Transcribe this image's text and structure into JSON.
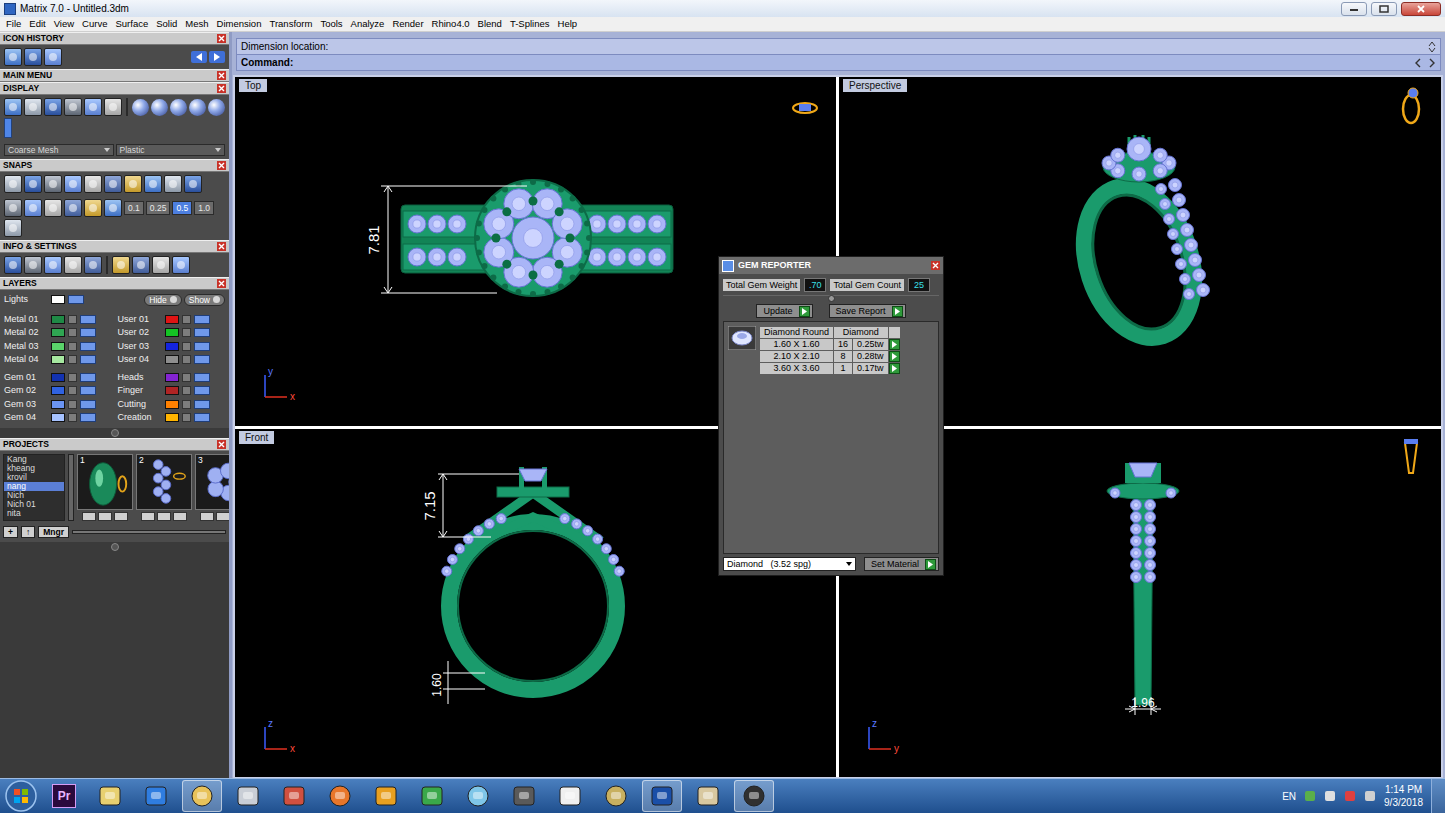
{
  "window": {
    "title": "Matrix 7.0 - Untitled.3dm"
  },
  "menu": [
    "File",
    "Edit",
    "View",
    "Curve",
    "Surface",
    "Solid",
    "Mesh",
    "Dimension",
    "Transform",
    "Tools",
    "Analyze",
    "Render",
    "Rhino4.0",
    "Blend",
    "T-Splines",
    "Help"
  ],
  "command": {
    "history": "Dimension location:",
    "prompt": "Command:"
  },
  "sidebar": {
    "icon_history": {
      "title": "ICON HISTORY"
    },
    "main_menu": {
      "title": "MAIN MENU"
    },
    "display": {
      "title": "DISPLAY",
      "mesh": "Coarse Mesh",
      "material": "Plastic"
    },
    "snaps": {
      "title": "SNAPS",
      "steps": [
        {
          "label": "0.1",
          "selected": false
        },
        {
          "label": "0.25",
          "selected": false
        },
        {
          "label": "0.5",
          "selected": true
        },
        {
          "label": "1.0",
          "selected": false
        }
      ]
    },
    "info": {
      "title": "INFO & SETTINGS"
    },
    "layers": {
      "title": "LAYERS",
      "lights": {
        "name": "Lights",
        "color": "#ffffff"
      },
      "hide": "Hide",
      "show": "Show",
      "left": [
        {
          "name": "Metal 01",
          "color": "#1f8a46"
        },
        {
          "name": "Metal 02",
          "color": "#2fa552"
        },
        {
          "name": "Metal 03",
          "color": "#5ad36a"
        },
        {
          "name": "Metal 04",
          "color": "#a6e8a0"
        },
        {
          "name": "Gem 01",
          "color": "#1232b0"
        },
        {
          "name": "Gem 02",
          "color": "#3062e0"
        },
        {
          "name": "Gem 03",
          "color": "#6a94f2"
        },
        {
          "name": "Gem 04",
          "color": "#a6c2ff"
        }
      ],
      "right": [
        {
          "name": "User 01",
          "color": "#e01414"
        },
        {
          "name": "User 02",
          "color": "#14c424"
        },
        {
          "name": "User 03",
          "color": "#1424e0"
        },
        {
          "name": "User 04",
          "color": "#8e8e8e"
        },
        {
          "name": "Heads",
          "color": "#8424d2"
        },
        {
          "name": "Finger",
          "color": "#b02424"
        },
        {
          "name": "Cutting",
          "color": "#ff8000"
        },
        {
          "name": "Creation",
          "color": "#ffb400"
        }
      ]
    },
    "projects": {
      "title": "PROJECTS",
      "items": [
        {
          "label": "Kang",
          "selected": false
        },
        {
          "label": "kheang",
          "selected": false
        },
        {
          "label": "krovil",
          "selected": false
        },
        {
          "label": "nang",
          "selected": true
        },
        {
          "label": "Nich",
          "selected": false
        },
        {
          "label": "Nich 01",
          "selected": false
        },
        {
          "label": "nita",
          "selected": false
        }
      ],
      "thumbs": [
        "1",
        "2",
        "3"
      ],
      "buttons": [
        "+",
        "↑",
        "Mngr"
      ]
    }
  },
  "viewports": [
    {
      "label": "Top",
      "dimensions": [
        "7.81"
      ],
      "axes": [
        "y",
        "x"
      ]
    },
    {
      "label": "Perspective",
      "dimensions": [],
      "axes": []
    },
    {
      "label": "Front",
      "dimensions": [
        "7.15",
        "1.60"
      ],
      "axes": [
        "z",
        "x"
      ]
    },
    {
      "dimensions": [
        "1.96"
      ],
      "axes": [
        "z",
        "y"
      ]
    }
  ],
  "gem_reporter": {
    "title": "GEM REPORTER",
    "weight_label": "Total Gem Weight",
    "weight": ".70",
    "count_label": "Total Gem Count",
    "count": "25",
    "buttons": [
      "Update",
      "Save Report"
    ],
    "columns": [
      "Diamond Round",
      "Diamond"
    ],
    "rows": [
      [
        "1.60 X 1.60",
        "16",
        "0.25tw"
      ],
      [
        "2.10 X 2.10",
        "8",
        "0.28tw"
      ],
      [
        "3.60 X 3.60",
        "1",
        "0.17tw"
      ]
    ],
    "material": "Diamond   (3.52 spg)",
    "set_material": "Set Material"
  },
  "taskbar": {
    "apps": [
      {
        "label": "Pr",
        "active": false
      },
      {
        "active": false
      },
      {
        "active": false
      },
      {
        "active": true
      },
      {
        "active": false
      },
      {
        "active": false
      },
      {
        "active": false
      },
      {
        "active": false
      },
      {
        "active": false
      },
      {
        "active": false
      },
      {
        "active": false
      },
      {
        "active": false
      },
      {
        "active": false
      },
      {
        "active": true
      },
      {
        "active": false
      },
      {
        "active": true
      }
    ],
    "language": "EN",
    "time": "1:14 PM",
    "date": "9/3/2018"
  }
}
